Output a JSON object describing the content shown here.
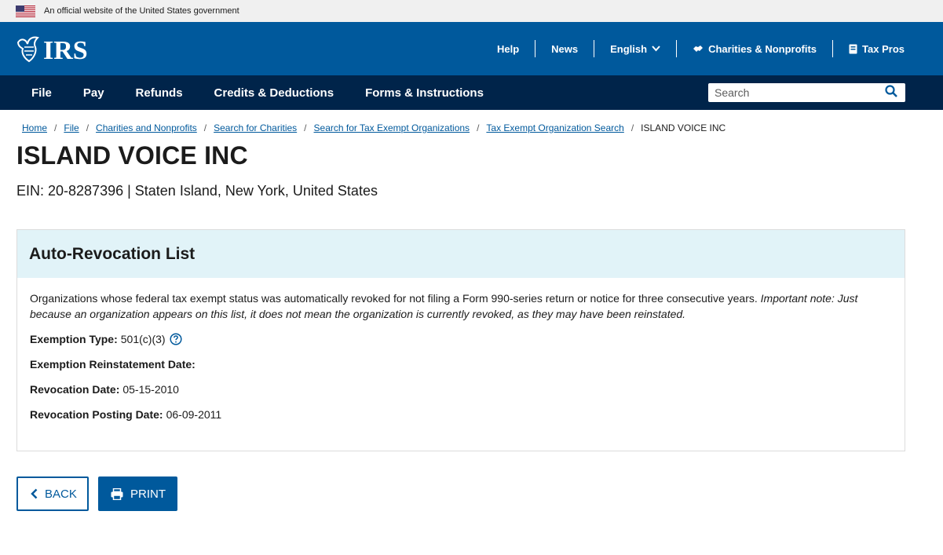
{
  "gov_banner": {
    "text": "An official website of the United States government",
    "flag_icon": "us-flag-icon"
  },
  "header": {
    "logo_text": "IRS",
    "utility": [
      {
        "label": "Help"
      },
      {
        "label": "News"
      },
      {
        "label": "English"
      },
      {
        "label": "Charities & Nonprofits",
        "icon": "handshake-icon"
      },
      {
        "label": "Tax Pros",
        "icon": "book-icon"
      }
    ],
    "colors": {
      "header_bg": "#00599c",
      "nav_bg": "#00244a"
    }
  },
  "nav": {
    "items": [
      {
        "label": "File"
      },
      {
        "label": "Pay"
      },
      {
        "label": "Refunds"
      },
      {
        "label": "Credits & Deductions"
      },
      {
        "label": "Forms & Instructions"
      }
    ],
    "search_placeholder": "Search"
  },
  "breadcrumb": {
    "items": [
      {
        "label": "Home"
      },
      {
        "label": "File"
      },
      {
        "label": "Charities and Nonprofits"
      },
      {
        "label": "Search for Charities"
      },
      {
        "label": "Search for Tax Exempt Organizations"
      },
      {
        "label": "Tax Exempt Organization Search"
      }
    ],
    "current": "ISLAND VOICE INC"
  },
  "org": {
    "name": "ISLAND VOICE INC",
    "ein_line": "EIN: 20-8287396 | Staten Island, New York, United States"
  },
  "panel": {
    "title": "Auto-Revocation List",
    "description": "Organizations whose federal tax exempt status was automatically revoked for not filing a Form 990-series return or notice for three consecutive years.",
    "note": "Important note: Just because an organization appears on this list, it does not mean the organization is currently revoked, as they may have been reinstated.",
    "fields": [
      {
        "label": "Exemption Type:",
        "value": "501(c)(3)"
      },
      {
        "label": "Exemption Reinstatement Date:",
        "value": ""
      },
      {
        "label": "Revocation Date:",
        "value": "05-15-2010"
      },
      {
        "label": "Revocation Posting Date:",
        "value": "06-09-2011"
      }
    ]
  },
  "buttons": {
    "back": "BACK",
    "print": "PRINT"
  }
}
